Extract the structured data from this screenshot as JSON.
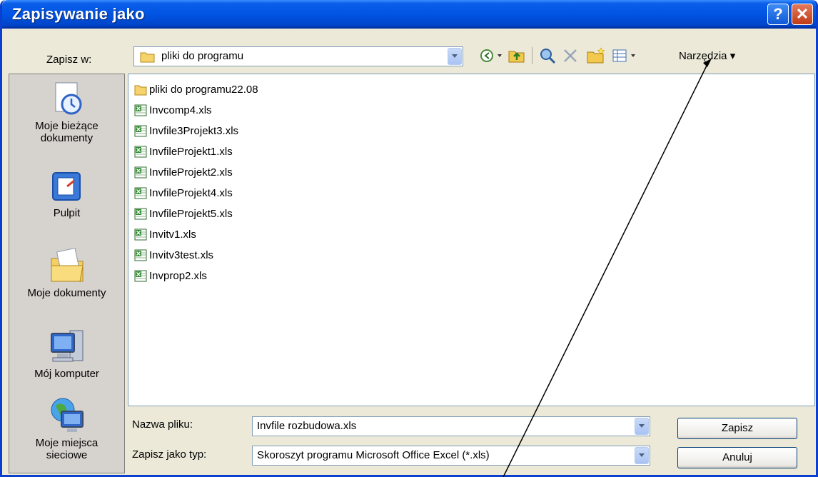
{
  "window": {
    "title": "Zapisywanie jako"
  },
  "save_in": {
    "label": "Zapisz w:",
    "value": "pliki do programu"
  },
  "toolbar": {
    "tools_label": "Narzędzia"
  },
  "places": [
    {
      "label_line1": "Moje bieżące",
      "label_line2": "dokumenty",
      "icon": "recent-documents-icon"
    },
    {
      "label_line1": "Pulpit",
      "label_line2": "",
      "icon": "desktop-icon"
    },
    {
      "label_line1": "Moje dokumenty",
      "label_line2": "",
      "icon": "my-documents-icon"
    },
    {
      "label_line1": "Mój komputer",
      "label_line2": "",
      "icon": "my-computer-icon"
    },
    {
      "label_line1": "Moje miejsca",
      "label_line2": "sieciowe",
      "icon": "network-places-icon"
    }
  ],
  "files": [
    {
      "name": "pliki do programu22.08",
      "type": "folder"
    },
    {
      "name": "Invcomp4.xls",
      "type": "xls"
    },
    {
      "name": "Invfile3Projekt3.xls",
      "type": "xls"
    },
    {
      "name": "InvfileProjekt1.xls",
      "type": "xls"
    },
    {
      "name": "InvfileProjekt2.xls",
      "type": "xls"
    },
    {
      "name": "InvfileProjekt4.xls",
      "type": "xls"
    },
    {
      "name": "InvfileProjekt5.xls",
      "type": "xls"
    },
    {
      "name": "Invitv1.xls",
      "type": "xls"
    },
    {
      "name": "Invitv3test.xls",
      "type": "xls"
    },
    {
      "name": "Invprop2.xls",
      "type": "xls"
    }
  ],
  "filename": {
    "label": "Nazwa pliku:",
    "value": "Invfile rozbudowa.xls"
  },
  "filetype": {
    "label": "Zapisz jako typ:",
    "value": "Skoroszyt programu Microsoft Office Excel (*.xls)"
  },
  "buttons": {
    "save": "Zapisz",
    "cancel": "Anuluj"
  },
  "colors": {
    "titlebar": "#0054e3",
    "dialog_bg": "#ece9d8"
  }
}
